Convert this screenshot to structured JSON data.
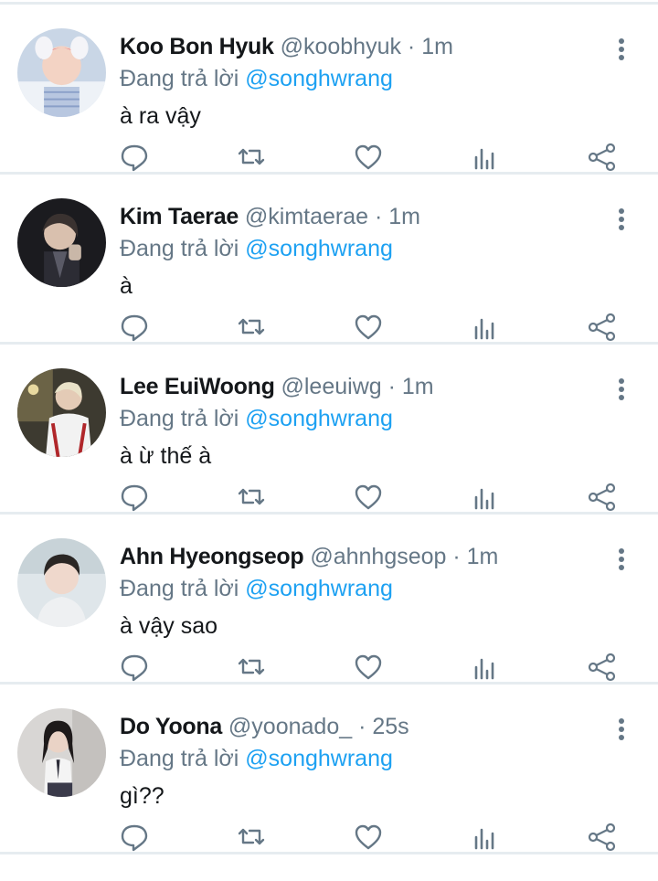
{
  "reply_prefix": "Đang trả lời",
  "reply_to": "@songhwrang",
  "colors": {
    "link": "#1da1f2",
    "secondary": "#657786",
    "divider": "#e6ecf0"
  },
  "icons": [
    "reply-icon",
    "retweet-icon",
    "like-icon",
    "stats-icon",
    "share-icon",
    "more-icon"
  ],
  "tweets": [
    {
      "name": "Koo Bon Hyuk",
      "handle": "@koobhyuk",
      "time": "1m",
      "text": "à ra vậy"
    },
    {
      "name": "Kim Taerae",
      "handle": "@kimtaerae",
      "time": "1m",
      "text": "à"
    },
    {
      "name": "Lee EuiWoong",
      "handle": "@leeuiwg",
      "time": "1m",
      "text": "à ừ thế à"
    },
    {
      "name": "Ahn Hyeongseop",
      "handle": "@ahnhgseop",
      "time": "1m",
      "text": "à vậy sao"
    },
    {
      "name": "Do Yoona",
      "handle": "@yoonado_",
      "time": "25s",
      "text": "gì??"
    }
  ]
}
